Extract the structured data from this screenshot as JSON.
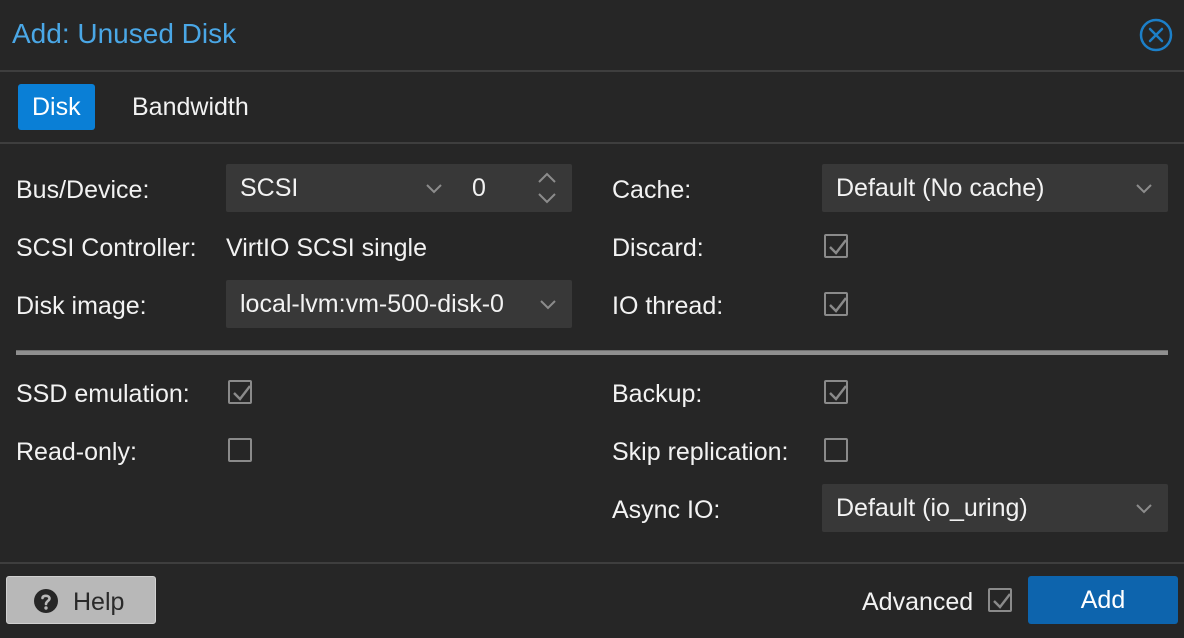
{
  "dialog": {
    "title": "Add: Unused Disk",
    "close_icon": "close-circle-icon"
  },
  "tabs": [
    {
      "label": "Disk",
      "active": true
    },
    {
      "label": "Bandwidth",
      "active": false
    }
  ],
  "form": {
    "bus_device": {
      "label": "Bus/Device:",
      "bus": "SCSI",
      "device": "0"
    },
    "scsi_controller": {
      "label": "SCSI Controller:",
      "value": "VirtIO SCSI single"
    },
    "disk_image": {
      "label": "Disk image:",
      "value": "local-lvm:vm-500-disk-0"
    },
    "cache": {
      "label": "Cache:",
      "value": "Default (No cache)"
    },
    "discard": {
      "label": "Discard:",
      "checked": true
    },
    "io_thread": {
      "label": "IO thread:",
      "checked": true
    },
    "ssd_emulation": {
      "label": "SSD emulation:",
      "checked": true
    },
    "read_only": {
      "label": "Read-only:",
      "checked": false
    },
    "backup": {
      "label": "Backup:",
      "checked": true
    },
    "skip_replication": {
      "label": "Skip replication:",
      "checked": false
    },
    "async_io": {
      "label": "Async IO:",
      "value": "Default (io_uring)"
    }
  },
  "footer": {
    "help_label": "Help",
    "advanced_label": "Advanced",
    "advanced_checked": true,
    "add_label": "Add"
  },
  "colors": {
    "background": "#262626",
    "title": "#4aa7e6",
    "active_tab": "#0a7fd6",
    "primary_button": "#0d64ad"
  }
}
